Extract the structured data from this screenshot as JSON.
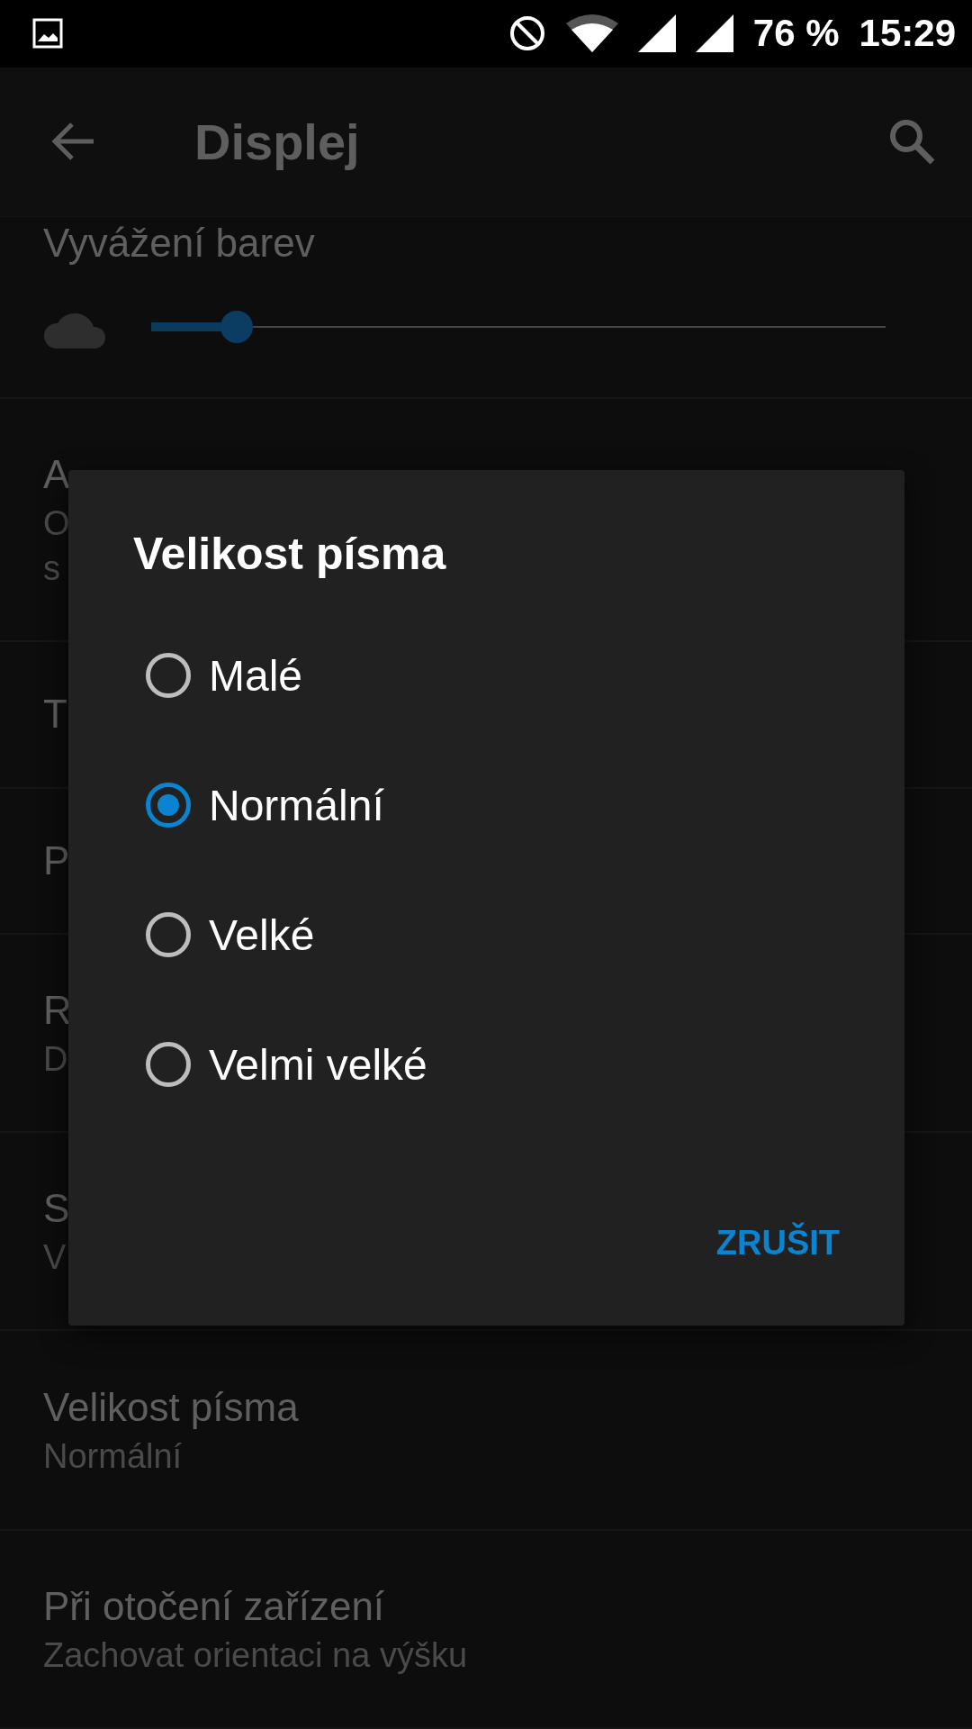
{
  "status_bar": {
    "battery": "76 %",
    "time": "15:29"
  },
  "toolbar": {
    "title": "Displej"
  },
  "color_balance": {
    "title": "Vyvážení barev",
    "level": 0.116
  },
  "settings": [
    {
      "title": "A",
      "subtitle_lines": [
        "O",
        "s"
      ]
    },
    {
      "title": "T"
    },
    {
      "title": "P"
    },
    {
      "title": "R",
      "subtitle_lines": [
        "D"
      ]
    },
    {
      "title": "S",
      "subtitle_lines": [
        "V"
      ]
    },
    {
      "title": "Velikost písma",
      "subtitle_lines": [
        "Normální"
      ]
    },
    {
      "title": "Při otočení zařízení",
      "subtitle_lines": [
        "Zachovat orientaci na výšku"
      ]
    }
  ],
  "dialog": {
    "title": "Velikost písma",
    "options": [
      {
        "label": "Malé",
        "selected": false
      },
      {
        "label": "Normální",
        "selected": true
      },
      {
        "label": "Velké",
        "selected": false
      },
      {
        "label": "Velmi velké",
        "selected": false
      }
    ],
    "cancel": "ZRUŠIT"
  }
}
